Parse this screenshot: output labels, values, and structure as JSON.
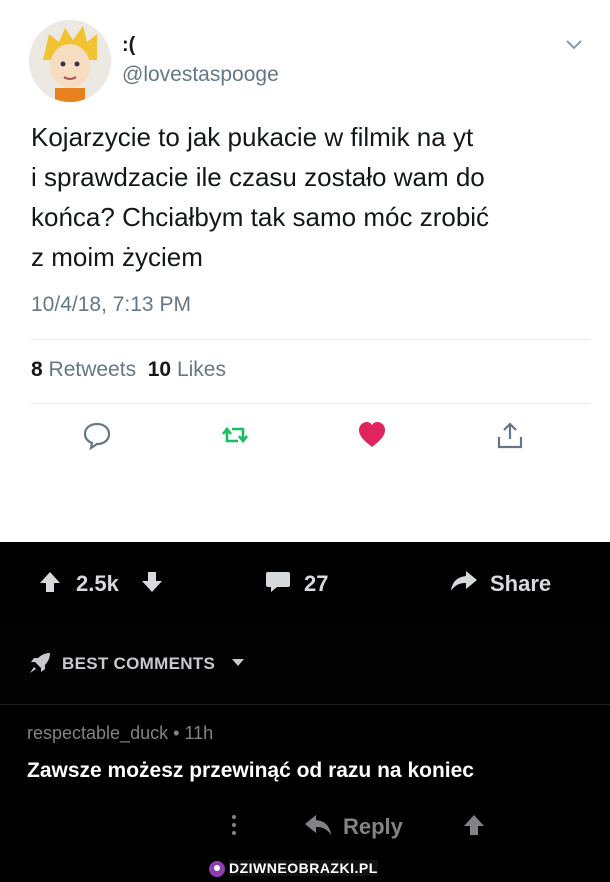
{
  "tweet": {
    "display_name": ":(",
    "handle": "@lovestaspooge",
    "text": "Kojarzycie to jak pukacie w filmik na yt\ni sprawdzacie ile czasu zostało wam do\nkońca? Chciałbym tak samo móc zrobić\nz moim życiem",
    "timestamp": "10/4/18, 7:13 PM",
    "retweets_count": "8",
    "retweets_label": "Retweets",
    "likes_count": "10",
    "likes_label": "Likes"
  },
  "post_bar": {
    "score": "2.5k",
    "comments_count": "27",
    "share_label": "Share"
  },
  "comments_section": {
    "sort_label": "BEST COMMENTS"
  },
  "comment": {
    "author": "respectable_duck",
    "age": "11h",
    "separator": "•",
    "body": "Zawsze możesz przewinąć od razu na koniec",
    "reply_label": "Reply"
  },
  "watermark": "DZIWNEOBRAZKI.PL",
  "colors": {
    "retweet_green": "#17bf63",
    "like_red": "#e0245e",
    "twitter_gray": "#657786",
    "reddit_gray": "#818384"
  },
  "icons": [
    "avatar-image",
    "chevron-down-icon",
    "reply-icon",
    "retweet-icon",
    "heart-icon",
    "share-icon",
    "upvote-icon",
    "downvote-icon",
    "comment-bubble-icon",
    "share-arrow-icon",
    "rocket-icon",
    "sort-caret-icon",
    "more-dots-icon",
    "reply-arrow-icon"
  ]
}
